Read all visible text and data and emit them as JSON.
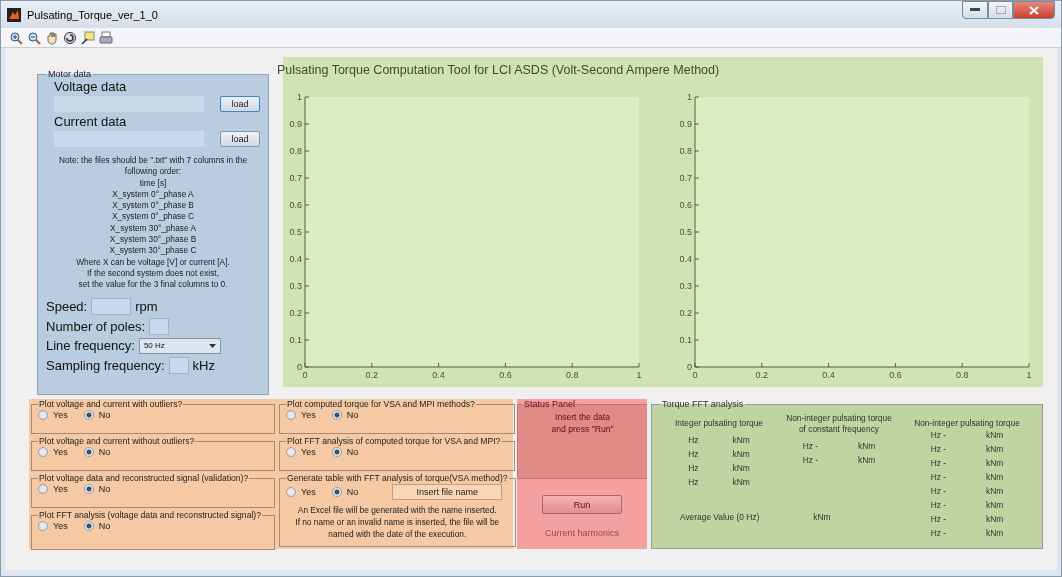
{
  "window": {
    "title": "Pulsating_Torque_ver_1_0"
  },
  "header": {
    "title": "Pulsating Torque Computation Tool for LCI ASDS (Volt-Second Ampere Method)"
  },
  "charts": [
    {
      "yticks": [
        "1",
        "0.9",
        "0.8",
        "0.7",
        "0.6",
        "0.5",
        "0.4",
        "0.3",
        "0.2",
        "0.1",
        "0"
      ],
      "xticks": [
        "0",
        "0.2",
        "0.4",
        "0.6",
        "0.8",
        "1"
      ]
    },
    {
      "yticks": [
        "1",
        "0.9",
        "0.8",
        "0.7",
        "0.6",
        "0.5",
        "0.4",
        "0.3",
        "0.2",
        "0.1",
        "0"
      ],
      "xticks": [
        "0",
        "0.2",
        "0.4",
        "0.6",
        "0.8",
        "1"
      ]
    }
  ],
  "motor_data": {
    "legend": "Motor data",
    "files": [
      {
        "label": "Voltage data",
        "button": "load",
        "focused": true
      },
      {
        "label": "Current data",
        "button": "load",
        "focused": false
      }
    ],
    "note": [
      "Note: the files should be \".txt\" with 7 columns in the following order:",
      "time [s]",
      "X_system 0°_phase A",
      "X_system 0°_phase B",
      "X_system 0°_phase C",
      "X_system 30°_phase A",
      "X_system 30°_phase B",
      "X_system 30°_phase C",
      "Where X can be voltage [V] or current [A].",
      "If the second system does not exist,",
      "set the value for the 3 final columns to 0."
    ],
    "speed": {
      "label": "Speed:",
      "unit": "rpm"
    },
    "poles": {
      "label": "Number of poles:"
    },
    "line_frequency": {
      "label": "Line frequency:",
      "value": "50 Hz"
    },
    "sampling": {
      "label": "Sampling frequency:",
      "unit": "kHz"
    }
  },
  "options_left": [
    {
      "legend": "Plot voltage and current with outliers?",
      "options": [
        {
          "label": "Yes",
          "selected": false
        },
        {
          "label": "No",
          "selected": true
        }
      ]
    },
    {
      "legend": "Plot voltage and current without outliers?",
      "options": [
        {
          "label": "Yes",
          "selected": false
        },
        {
          "label": "No",
          "selected": true
        }
      ]
    },
    {
      "legend": "Plot voltage data and reconstructed signal (validation)?",
      "options": [
        {
          "label": "Yes",
          "selected": false
        },
        {
          "label": "No",
          "selected": true
        }
      ]
    },
    {
      "legend": "Plot FFT analysis (voltage data and reconstructed signal)?",
      "options": [
        {
          "label": "Yes",
          "selected": false
        },
        {
          "label": "No",
          "selected": true
        }
      ]
    }
  ],
  "options_right": [
    {
      "legend": "Plot computed torque for VSA and MPI methods?",
      "options": [
        {
          "label": "Yes",
          "selected": false
        },
        {
          "label": "No",
          "selected": true
        }
      ]
    },
    {
      "legend": "Plot FFT analysis of computed torque for VSA and MPI?",
      "options": [
        {
          "label": "Yes",
          "selected": false
        },
        {
          "label": "No",
          "selected": true
        }
      ]
    },
    {
      "legend": "Generate table with FFT analysis of torque(VSA method)?",
      "options": [
        {
          "label": "Yes",
          "selected": false
        },
        {
          "label": "No",
          "selected": true
        }
      ],
      "file_name": "Insert file name",
      "note": [
        "An Excel file will be generated with the name inserted.",
        "If no name or an invalid name is inserted, the file will be",
        "named with the date of the execution."
      ]
    }
  ],
  "status_panel": {
    "legend": "Status Panel",
    "message": [
      "Insert the data",
      "and press \"Run\""
    ],
    "buttons": [
      {
        "label": "Run",
        "disabled": false
      },
      {
        "label": "Current harmonics",
        "disabled": true
      }
    ]
  },
  "torque_fft": {
    "legend": "Torque FFT analysis",
    "columns": [
      {
        "title": [
          "Integer pulsating torque"
        ],
        "rows": [
          {
            "frequency": "Hz",
            "torque": "kNm"
          },
          {
            "frequency": "Hz",
            "torque": "kNm"
          },
          {
            "frequency": "Hz",
            "torque": "kNm"
          },
          {
            "frequency": "Hz",
            "torque": "kNm"
          }
        ]
      },
      {
        "title": [
          "Non-integer pulsating torque",
          "of constant frequency"
        ],
        "rows": [
          {
            "frequency": "Hz -",
            "torque": "kNm"
          },
          {
            "frequency": "Hz -",
            "torque": "kNm"
          }
        ]
      },
      {
        "title": [
          "Non-integer pulsating torque"
        ],
        "rows": [
          {
            "frequency": "Hz -",
            "torque": "kNm"
          },
          {
            "frequency": "Hz -",
            "torque": "kNm"
          },
          {
            "frequency": "Hz -",
            "torque": "kNm"
          },
          {
            "frequency": "Hz -",
            "torque": "kNm"
          },
          {
            "frequency": "Hz -",
            "torque": "kNm"
          },
          {
            "frequency": "Hz -",
            "torque": "kNm"
          },
          {
            "frequency": "Hz -",
            "torque": "kNm"
          },
          {
            "frequency": "Hz -",
            "torque": "kNm"
          }
        ]
      }
    ],
    "average": {
      "label": "Average Value (0 Hz)",
      "unit": "kNm"
    }
  }
}
